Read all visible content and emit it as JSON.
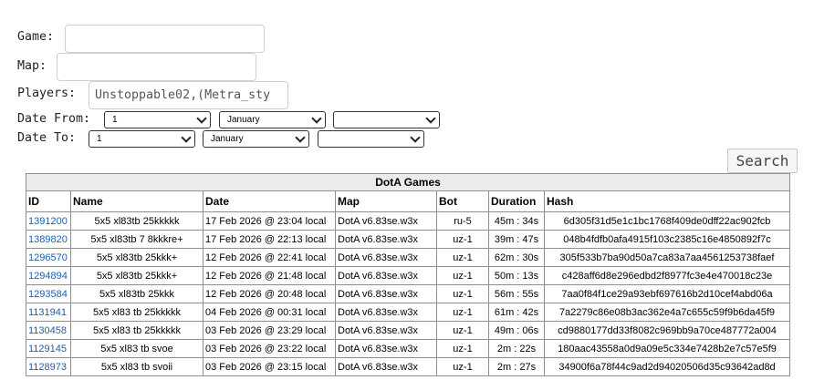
{
  "form": {
    "game_label": "Game:",
    "game_value": "",
    "map_label": "Map:",
    "map_value": "",
    "players_label": "Players:",
    "players_value": "Unstoppable02,(Metra_sty",
    "date_from_label": "Date From:",
    "date_to_label": "Date To:",
    "from_day": "1",
    "from_month": "January",
    "from_year": "",
    "to_day": "1",
    "to_month": "January",
    "to_year": "",
    "search_label": "Search"
  },
  "table": {
    "caption": "DotA Games",
    "columns": [
      "ID",
      "Name",
      "Date",
      "Map",
      "Bot",
      "Duration",
      "Hash"
    ],
    "rows": [
      {
        "id": "1391200",
        "name": "5x5 xl83tb 25kkkkk",
        "date": "17 Feb 2026 @ 23:04 local",
        "map": "DotA v6.83se.w3x",
        "bot": "ru-5",
        "duration": "45m : 34s",
        "hash": "6d305f31d5e1c1bc1768f409de0dff22ac902fcb"
      },
      {
        "id": "1389820",
        "name": "5x5 xl83tb 7 8kkkre+",
        "date": "17 Feb 2026 @ 22:13 local",
        "map": "DotA v6.83se.w3x",
        "bot": "uz-1",
        "duration": "39m : 47s",
        "hash": "048b4fdfb0afa4915f103c2385c16e4850892f7c"
      },
      {
        "id": "1296570",
        "name": "5x5 xl83tb 25kkk+",
        "date": "12 Feb 2026 @ 22:41 local",
        "map": "DotA v6.83se.w3x",
        "bot": "uz-1",
        "duration": "62m : 30s",
        "hash": "305f533b7ba90d50a7ca83a7aa4561253738faef"
      },
      {
        "id": "1294894",
        "name": "5x5 xl83tb 25kkk+",
        "date": "12 Feb 2026 @ 21:48 local",
        "map": "DotA v6.83se.w3x",
        "bot": "uz-1",
        "duration": "50m : 13s",
        "hash": "c428aff6d8e296edbd2f8977fc3e4e470018c23e"
      },
      {
        "id": "1293584",
        "name": "5x5 xl83tb 25kkk",
        "date": "12 Feb 2026 @ 20:48 local",
        "map": "DotA v6.83se.w3x",
        "bot": "uz-1",
        "duration": "56m : 55s",
        "hash": "7aa0f84f1ce29a93ebf697616b2d10cef4abd06a"
      },
      {
        "id": "1131941",
        "name": "5x5 xl83 tb 25kkkkk",
        "date": "04 Feb 2026 @ 00:31 local",
        "map": "DotA v6.83se.w3x",
        "bot": "uz-1",
        "duration": "61m : 42s",
        "hash": "7a2279c86e08b3ac362e4a7c655c59f9b6da45f9"
      },
      {
        "id": "1130458",
        "name": "5x5 xl83 tb 25kkkkk",
        "date": "03 Feb 2026 @ 23:29 local",
        "map": "DotA v6.83se.w3x",
        "bot": "uz-1",
        "duration": "49m : 06s",
        "hash": "cd9880177dd33f8082c969bb9a70ce487772a004"
      },
      {
        "id": "1129145",
        "name": "5x5 xl83 tb svoe",
        "date": "03 Feb 2026 @ 23:22 local",
        "map": "DotA v6.83se.w3x",
        "bot": "uz-1",
        "duration": "2m : 22s",
        "hash": "180aac43558a0d9a09e5c334e7428b2e7c57e5f9"
      },
      {
        "id": "1128973",
        "name": "5x5 xl83 tb svoii",
        "date": "03 Feb 2026 @ 23:15 local",
        "map": "DotA v6.83se.w3x",
        "bot": "uz-1",
        "duration": "2m : 27s",
        "hash": "34900f6a78f44c9ad2d94020506d35c93642ad8d"
      }
    ]
  }
}
